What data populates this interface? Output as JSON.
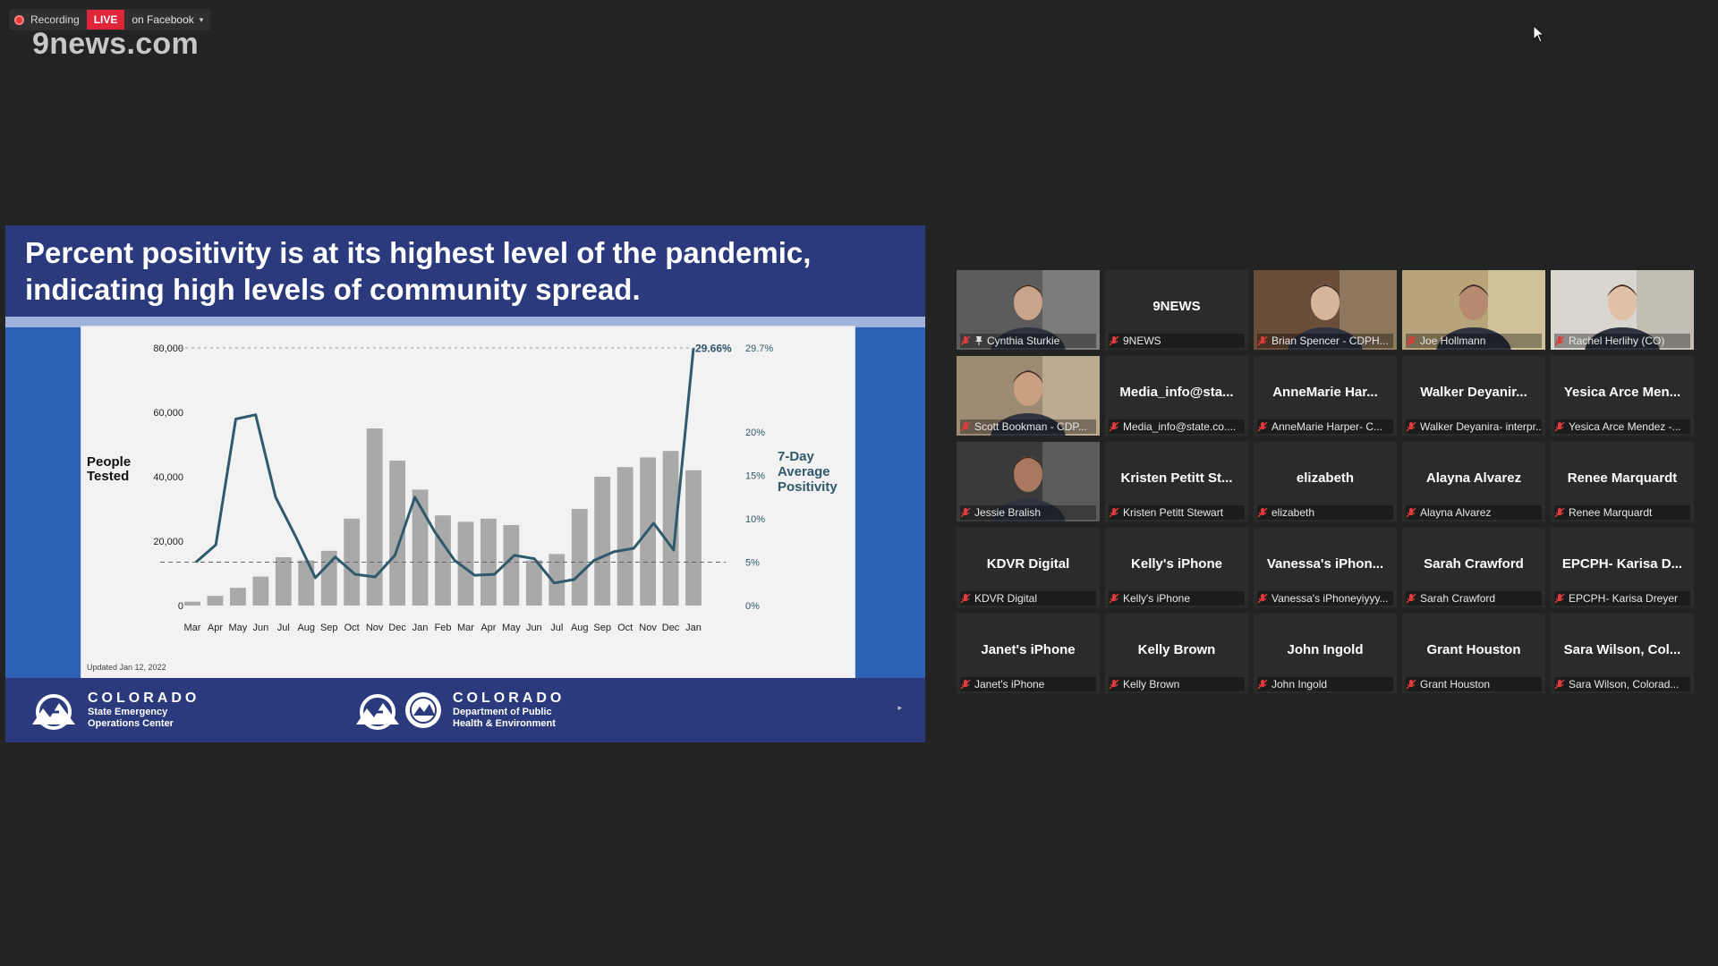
{
  "recording": {
    "label": "Recording",
    "live_badge": "LIVE",
    "platform": "on Facebook",
    "caret": "▾"
  },
  "watermark": "9news.com",
  "slide": {
    "title": "Percent positivity is at its highest level of the pandemic, indicating high levels of community spread.",
    "footer_logos": [
      {
        "state": "COLORADO",
        "line1": "State Emergency",
        "line2": "Operations Center"
      },
      {
        "state": "COLORADO",
        "line1": "Department of Public",
        "line2": "Health & Environment",
        "seal": "CDPHE"
      }
    ],
    "marker": "▸"
  },
  "chart_data": {
    "type": "bar",
    "left_axis_title": [
      "People",
      "Tested"
    ],
    "right_axis_title": [
      "7-Day",
      "Average",
      "Positivity"
    ],
    "y_left_ticks": [
      "80,000",
      "60,000",
      "40,000",
      "20,000",
      "0"
    ],
    "y_left_range": [
      0,
      80000
    ],
    "y_right_ticks": [
      "29.7%",
      "20%",
      "15%",
      "10%",
      "5%",
      "0%"
    ],
    "y_right_range": [
      0,
      29.7
    ],
    "x_ticks": [
      "Mar",
      "Apr",
      "May",
      "Jun",
      "Jul",
      "Aug",
      "Sep",
      "Oct",
      "Nov",
      "Dec",
      "Jan",
      "Feb",
      "Mar",
      "Apr",
      "May",
      "Jun",
      "Jul",
      "Aug",
      "Sep",
      "Oct",
      "Nov",
      "Dec",
      "Jan"
    ],
    "peak_label": "29.66%",
    "reference_line_pct": 5,
    "updated": "Updated Jan 12, 2022",
    "people_tested_bars": [
      {
        "month": "Mar 2020",
        "value": 1200
      },
      {
        "month": "Apr 2020",
        "value": 3000
      },
      {
        "month": "May 2020",
        "value": 5500
      },
      {
        "month": "Jun 2020",
        "value": 9000
      },
      {
        "month": "Jul 2020",
        "value": 15000
      },
      {
        "month": "Aug 2020",
        "value": 14000
      },
      {
        "month": "Sep 2020",
        "value": 17000
      },
      {
        "month": "Oct 2020",
        "value": 27000
      },
      {
        "month": "Nov 2020",
        "value": 55000
      },
      {
        "month": "Dec 2020",
        "value": 45000
      },
      {
        "month": "Jan 2021",
        "value": 36000
      },
      {
        "month": "Feb 2021",
        "value": 28000
      },
      {
        "month": "Mar 2021",
        "value": 26000
      },
      {
        "month": "Apr 2021",
        "value": 27000
      },
      {
        "month": "May 2021",
        "value": 25000
      },
      {
        "month": "Jun 2021",
        "value": 14000
      },
      {
        "month": "Jul 2021",
        "value": 16000
      },
      {
        "month": "Aug 2021",
        "value": 30000
      },
      {
        "month": "Sep 2021",
        "value": 40000
      },
      {
        "month": "Oct 2021",
        "value": 43000
      },
      {
        "month": "Nov 2021",
        "value": 46000
      },
      {
        "month": "Dec 2021",
        "value": 48000
      },
      {
        "month": "Jan 2022",
        "value": 42000
      }
    ],
    "positivity_line": [
      {
        "month": "Mar 2020",
        "pct": 5.0
      },
      {
        "month": "Mar 2020 late",
        "pct": 7.0
      },
      {
        "month": "Apr 2020",
        "pct": 21.5
      },
      {
        "month": "Apr 2020 late",
        "pct": 22.0
      },
      {
        "month": "May 2020",
        "pct": 12.5
      },
      {
        "month": "May 2020 late",
        "pct": 8.0
      },
      {
        "month": "Jun 2020",
        "pct": 3.2
      },
      {
        "month": "Jul 2020",
        "pct": 5.6
      },
      {
        "month": "Aug 2020",
        "pct": 3.6
      },
      {
        "month": "Sep 2020",
        "pct": 3.3
      },
      {
        "month": "Oct 2020",
        "pct": 5.8
      },
      {
        "month": "Nov 2020",
        "pct": 12.5
      },
      {
        "month": "Dec 2020",
        "pct": 8.5
      },
      {
        "month": "Jan 2021",
        "pct": 5.2
      },
      {
        "month": "Feb 2021",
        "pct": 3.5
      },
      {
        "month": "Mar 2021",
        "pct": 3.6
      },
      {
        "month": "Apr 2021",
        "pct": 5.8
      },
      {
        "month": "May 2021",
        "pct": 5.4
      },
      {
        "month": "Jun 2021",
        "pct": 2.6
      },
      {
        "month": "Jul 2021",
        "pct": 3.0
      },
      {
        "month": "Aug 2021",
        "pct": 5.2
      },
      {
        "month": "Sep 2021",
        "pct": 6.2
      },
      {
        "month": "Oct 2021",
        "pct": 6.6
      },
      {
        "month": "Nov 2021",
        "pct": 9.5
      },
      {
        "month": "Dec 2021",
        "pct": 6.4
      },
      {
        "month": "Jan 2022",
        "pct": 29.66
      }
    ]
  },
  "participants": [
    {
      "big": "",
      "label": "Cynthia Sturkie",
      "video": true,
      "active": true,
      "pinned": true
    },
    {
      "big": "9NEWS",
      "label": "9NEWS",
      "video": false
    },
    {
      "big": "",
      "label": "Brian Spencer - CDPH...",
      "video": true
    },
    {
      "big": "",
      "label": "Joe Hollmann",
      "video": true
    },
    {
      "big": "",
      "label": "Rachel Herlihy (CO)",
      "video": true
    },
    {
      "big": "",
      "label": "Scott Bookman - CDP...",
      "video": true
    },
    {
      "big": "Media_info@sta...",
      "label": "Media_info@state.co....",
      "video": false
    },
    {
      "big": "AnneMarie Har...",
      "label": "AnneMarie Harper- C...",
      "video": false
    },
    {
      "big": "Walker Deyanir...",
      "label": "Walker Deyanira- interpr...",
      "video": false
    },
    {
      "big": "Yesica Arce Men...",
      "label": "Yesica Arce Mendez -...",
      "video": false
    },
    {
      "big": "",
      "label": "Jessie Bralish",
      "video": true
    },
    {
      "big": "Kristen Petitt St...",
      "label": "Kristen Petitt Stewart",
      "video": false
    },
    {
      "big": "elizabeth",
      "label": "elizabeth",
      "video": false
    },
    {
      "big": "Alayna Alvarez",
      "label": "Alayna Alvarez",
      "video": false
    },
    {
      "big": "Renee Marquardt",
      "label": "Renee Marquardt",
      "video": false
    },
    {
      "big": "KDVR Digital",
      "label": "KDVR Digital",
      "video": false
    },
    {
      "big": "Kelly's iPhone",
      "label": "Kelly's iPhone",
      "video": false
    },
    {
      "big": "Vanessa's iPhon...",
      "label": "Vanessa's iPhoneyiyyy...",
      "video": false
    },
    {
      "big": "Sarah Crawford",
      "label": "Sarah Crawford",
      "video": false
    },
    {
      "big": "EPCPH- Karisa D...",
      "label": "EPCPH- Karisa Dreyer",
      "video": false
    },
    {
      "big": "Janet's iPhone",
      "label": "Janet's iPhone",
      "video": false
    },
    {
      "big": "Kelly Brown",
      "label": "Kelly Brown",
      "video": false
    },
    {
      "big": "John Ingold",
      "label": "John Ingold",
      "video": false
    },
    {
      "big": "Grant Houston",
      "label": "Grant Houston",
      "video": false
    },
    {
      "big": "Sara Wilson, Col...",
      "label": "Sara Wilson, Colorad...",
      "video": false
    }
  ],
  "colors": {
    "background": "#232323",
    "slide_navy": "#2a3a7d",
    "slide_blue": "#2e62b4",
    "line_teal": "#2f5a6b",
    "bars_gray": "#a9a9a9",
    "live_red": "#e0243a",
    "active_speaker": "#8bd23b",
    "mic_muted": "#e23b3b"
  },
  "icons": [
    "record-dot-icon",
    "caret-down-icon",
    "mouse-pointer-icon",
    "mic-muted-icon",
    "pin-icon",
    "colorado-logo-icon",
    "cdphe-seal-icon"
  ]
}
